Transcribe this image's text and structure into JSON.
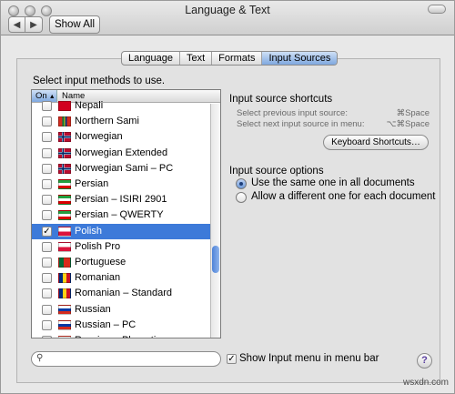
{
  "window": {
    "title": "Language & Text",
    "show_all": "Show All",
    "back_glyph": "◀",
    "forward_glyph": "▶"
  },
  "tabs": [
    {
      "label": "Language"
    },
    {
      "label": "Text"
    },
    {
      "label": "Formats"
    },
    {
      "label": "Input Sources",
      "active": true
    }
  ],
  "list": {
    "instruction": "Select input methods to use.",
    "col_on": "On",
    "col_on_arrow": "▲",
    "col_name": "Name",
    "rows": [
      {
        "label": "Nepali",
        "checked": false,
        "flag": "nepal"
      },
      {
        "label": "Northern Sami",
        "checked": false,
        "flag": "sami"
      },
      {
        "label": "Norwegian",
        "checked": false,
        "flag": "norway"
      },
      {
        "label": "Norwegian Extended",
        "checked": false,
        "flag": "norway"
      },
      {
        "label": "Norwegian Sami – PC",
        "checked": false,
        "flag": "norway"
      },
      {
        "label": "Persian",
        "checked": false,
        "flag": "iran"
      },
      {
        "label": "Persian – ISIRI 2901",
        "checked": false,
        "flag": "iran"
      },
      {
        "label": "Persian – QWERTY",
        "checked": false,
        "flag": "iran"
      },
      {
        "label": "Polish",
        "checked": true,
        "selected": true,
        "flag": "poland"
      },
      {
        "label": "Polish Pro",
        "checked": false,
        "flag": "pro"
      },
      {
        "label": "Portuguese",
        "checked": false,
        "flag": "portugal"
      },
      {
        "label": "Romanian",
        "checked": false,
        "flag": "romania"
      },
      {
        "label": "Romanian – Standard",
        "checked": false,
        "flag": "romania"
      },
      {
        "label": "Russian",
        "checked": false,
        "flag": "russia"
      },
      {
        "label": "Russian – PC",
        "checked": false,
        "flag": "russia-pc"
      },
      {
        "label": "Russian – Phonetic",
        "checked": false,
        "flag": "russia"
      }
    ],
    "check_glyph": "✓"
  },
  "search": {
    "placeholder": "",
    "icon": "magnifier-icon"
  },
  "shortcuts": {
    "heading": "Input source shortcuts",
    "prev_label": "Select previous input source:",
    "prev_key": "⌘Space",
    "next_label": "Select next input source in menu:",
    "next_key": "⌥⌘Space",
    "button": "Keyboard Shortcuts…"
  },
  "options": {
    "heading": "Input source options",
    "same": "Use the same one in all documents",
    "different": "Allow a different one for each document"
  },
  "show_menu": {
    "label": "Show Input menu in menu bar",
    "checked": true
  },
  "help": "?",
  "watermark": "wsxdn.com",
  "colors": {
    "selection": "#3d7ad9",
    "tab_active": "#7fa8df"
  }
}
